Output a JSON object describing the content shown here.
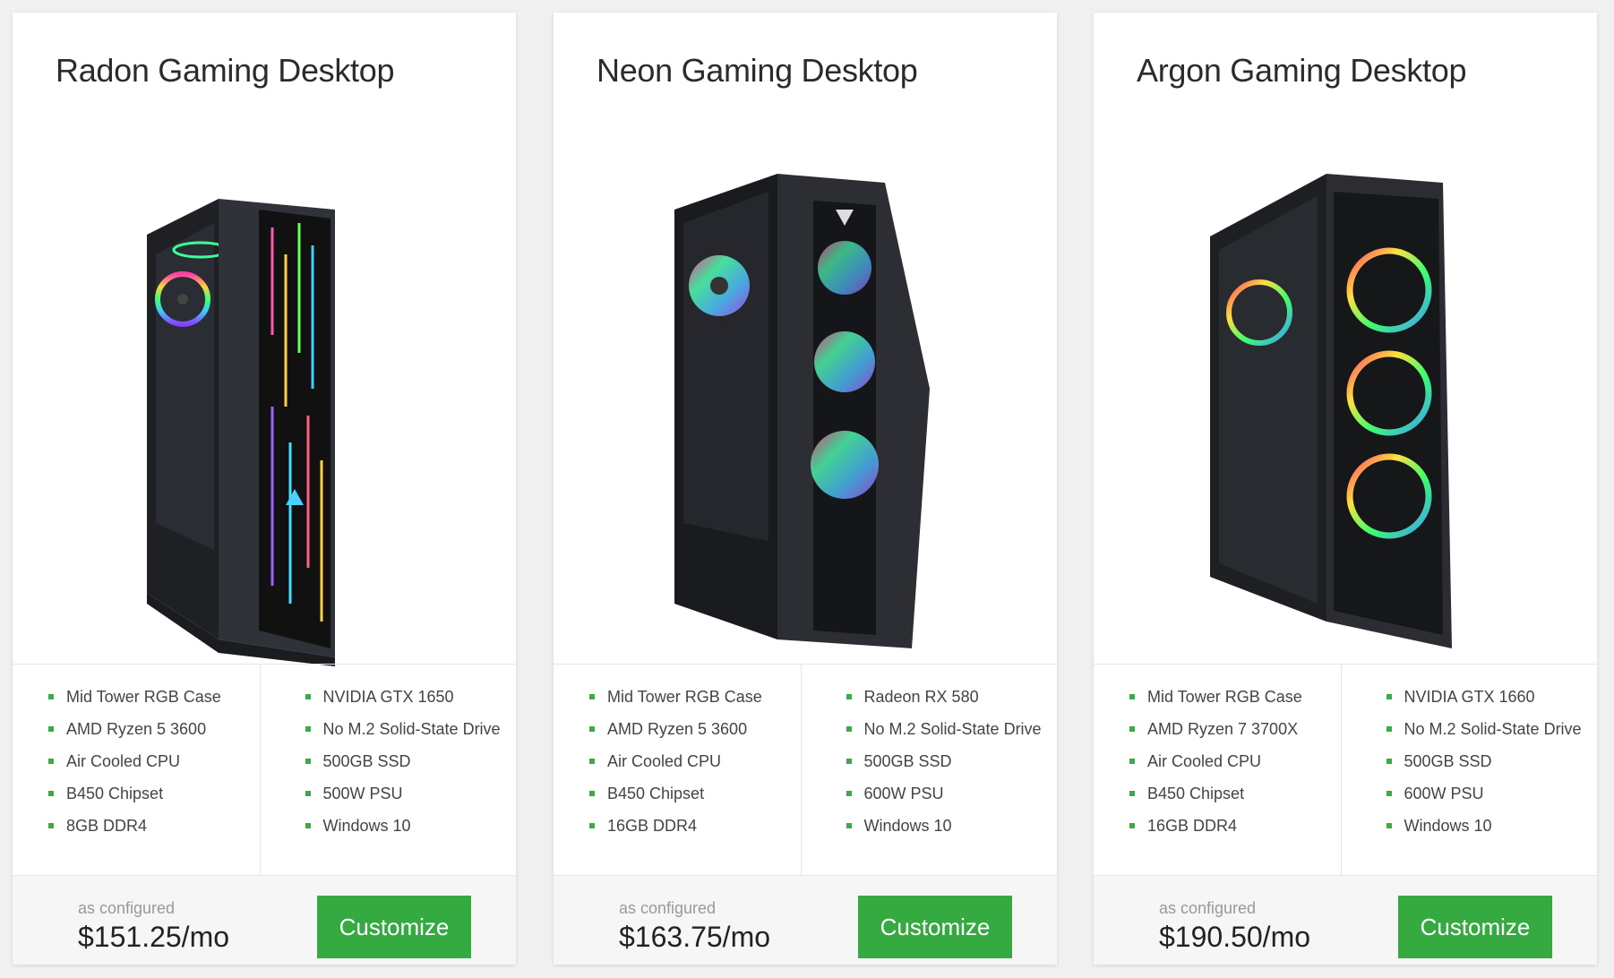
{
  "cards": [
    {
      "title": "Radon Gaming Desktop",
      "image_icon": "desktop-tower-icon",
      "specs_left": [
        "Mid Tower RGB Case",
        "AMD Ryzen 5 3600",
        "Air Cooled CPU",
        "B450 Chipset",
        "8GB DDR4"
      ],
      "specs_right": [
        "NVIDIA GTX 1650",
        "No M.2 Solid-State Drive",
        "500GB SSD",
        "500W PSU",
        "Windows 10"
      ],
      "price_label": "as configured",
      "price": "$151.25/mo",
      "button_label": "Customize"
    },
    {
      "title": "Neon Gaming Desktop",
      "image_icon": "desktop-tower-icon",
      "specs_left": [
        "Mid Tower RGB Case",
        "AMD Ryzen 5 3600",
        "Air Cooled CPU",
        "B450 Chipset",
        "16GB DDR4"
      ],
      "specs_right": [
        "Radeon RX 580",
        "No M.2 Solid-State Drive",
        "500GB SSD",
        "600W PSU",
        "Windows 10"
      ],
      "price_label": "as configured",
      "price": "$163.75/mo",
      "button_label": "Customize"
    },
    {
      "title": "Argon Gaming Desktop",
      "image_icon": "desktop-tower-icon",
      "specs_left": [
        "Mid Tower RGB Case",
        "AMD Ryzen 7 3700X",
        "Air Cooled CPU",
        "B450 Chipset",
        "16GB DDR4"
      ],
      "specs_right": [
        "NVIDIA GTX 1660",
        "No M.2 Solid-State Drive",
        "500GB SSD",
        "600W PSU",
        "Windows 10"
      ],
      "price_label": "as configured",
      "price": "$190.50/mo",
      "button_label": "Customize"
    }
  ],
  "colors": {
    "accent": "#34aa40",
    "bullet": "#3aab45",
    "background": "#f0f0f0"
  }
}
